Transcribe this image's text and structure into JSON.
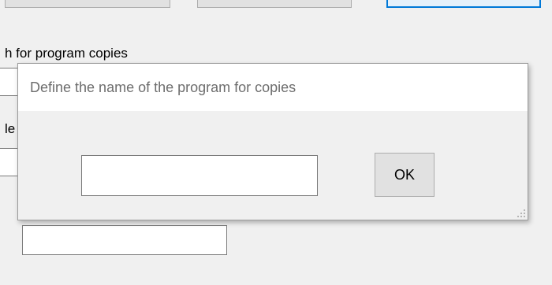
{
  "background": {
    "path_label": "h for program copies",
    "partial_label": "le"
  },
  "dialog": {
    "prompt": "Define the name of the program for copies",
    "name_input": {
      "value": "",
      "placeholder": ""
    },
    "ok_label": "OK"
  },
  "icons": {
    "resize_grip": "resize-grip-icon"
  },
  "colors": {
    "window_bg": "#f0f0f0",
    "header_bg": "#ffffff",
    "prompt_text": "#6d6d6d",
    "focus_accent": "#0078d7"
  }
}
